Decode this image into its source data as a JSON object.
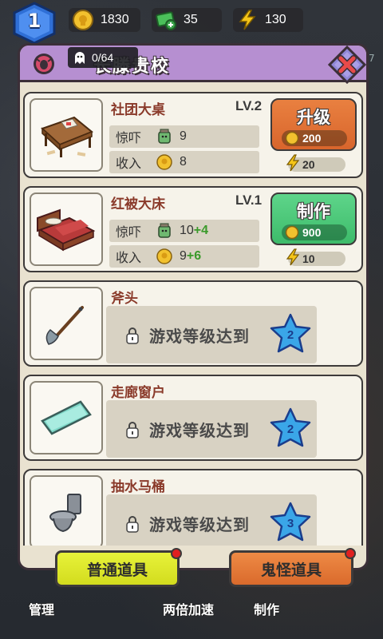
{
  "player": {
    "level": "1"
  },
  "resources": {
    "coins": "1830",
    "cash": "35",
    "energy": "130"
  },
  "panel": {
    "title": "长滕贵校",
    "ghost_count": "0/64",
    "side_number": "7"
  },
  "items": [
    {
      "name": "社团大桌",
      "level": "LV.2",
      "fright_label": "惊吓",
      "fright_value": "9",
      "fright_plus": "",
      "income_label": "收入",
      "income_value": "8",
      "income_plus": "",
      "action_label": "升级",
      "action_cost": "200",
      "energy_cost": "20"
    },
    {
      "name": "红被大床",
      "level": "LV.1",
      "fright_label": "惊吓",
      "fright_value": "10",
      "fright_plus": "+4",
      "income_label": "收入",
      "income_value": "9",
      "income_plus": "+6",
      "action_label": "制作",
      "action_cost": "900",
      "energy_cost": "10"
    },
    {
      "name": "斧头",
      "locked_text": "游戏等级达到",
      "required_level": "2"
    },
    {
      "name": "走廊窗户",
      "locked_text": "游戏等级达到",
      "required_level": "2"
    },
    {
      "name": "抽水马桶",
      "locked_text": "游戏等级达到",
      "required_level": "3"
    }
  ],
  "tabs": {
    "normal": "普通道具",
    "ghost": "鬼怪道具"
  },
  "bottom_nav": {
    "manage": "管理",
    "double_speed": "两倍加速",
    "craft": "制作"
  },
  "colors": {
    "header_purple": "#b68fd1",
    "upgrade_orange": "#e98040",
    "make_green": "#5ed58a",
    "tab_yellow": "#e7f23a",
    "tab_orange": "#ee8a45",
    "star_blue": "#3aa6e8"
  }
}
